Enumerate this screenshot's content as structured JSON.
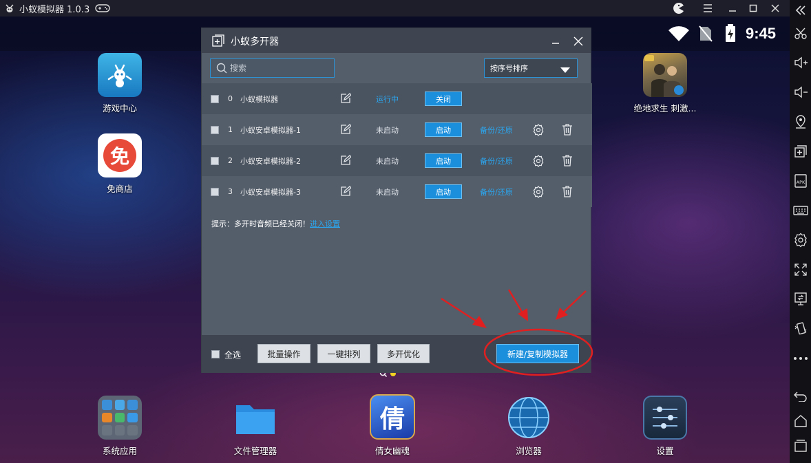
{
  "window": {
    "title": "小蚁模拟器 1.0.3"
  },
  "status": {
    "time": "9:45"
  },
  "desktop_apps": [
    {
      "label": "游戏中心"
    },
    {
      "label": "免商店",
      "glyph": "免"
    },
    {
      "label": "绝地求生 刺激..."
    }
  ],
  "dock_apps": [
    {
      "label": "系统应用"
    },
    {
      "label": "文件管理器"
    },
    {
      "label": "倩女幽魂",
      "glyph": "倩"
    },
    {
      "label": "浏览器"
    },
    {
      "label": "设置"
    }
  ],
  "dialog": {
    "title": "小蚁多开器",
    "search_placeholder": "搜索",
    "sort_label": "按序号排序",
    "rows": [
      {
        "index": "0",
        "name": "小蚁模拟器",
        "status": "运行中",
        "action": "关闭"
      },
      {
        "index": "1",
        "name": "小蚁安卓模拟器-1",
        "status": "未启动",
        "action": "启动",
        "backup": "备份/还原"
      },
      {
        "index": "2",
        "name": "小蚁安卓模拟器-2",
        "status": "未启动",
        "action": "启动",
        "backup": "备份/还原"
      },
      {
        "index": "3",
        "name": "小蚁安卓模拟器-3",
        "status": "未启动",
        "action": "启动",
        "backup": "备份/还原"
      }
    ],
    "tip_text": "提示：多开时音频已经关闭！",
    "tip_link": "进入设置",
    "select_all": "全选",
    "batch_btn": "批量操作",
    "arrange_btn": "一键排列",
    "optimize_btn": "多开优化",
    "new_btn": "新建/复制模拟器"
  },
  "colors": {
    "accent": "#1b8fdc",
    "link": "#2aa7f0",
    "annotation": "#e02020"
  }
}
